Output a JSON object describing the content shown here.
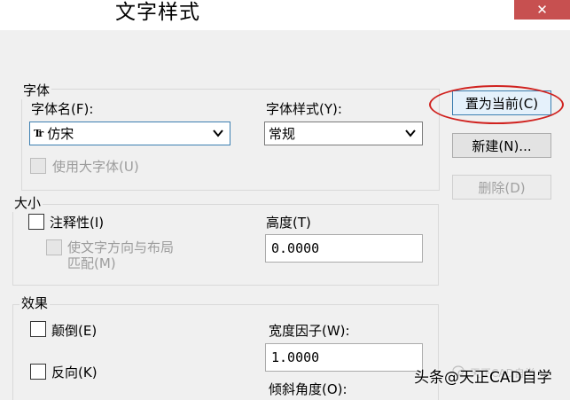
{
  "window": {
    "title": "文字样式",
    "close_glyph": "✕"
  },
  "font_group": {
    "legend": "字体",
    "font_name_label": "字体名(F):",
    "font_name_value": "仿宋",
    "font_name_icon": "Tr",
    "font_style_label": "字体样式(Y):",
    "font_style_value": "常规",
    "bigfont_label": "使用大字体(U)",
    "bigfont_checked": false
  },
  "size_group": {
    "legend": "大小",
    "annotative_label": "注释性(I)",
    "annotative_checked": false,
    "match_orientation_label_line1": "使文字方向与布局",
    "match_orientation_label_line2": "匹配(M)",
    "height_label": "高度(T)",
    "height_value": "0.0000"
  },
  "effects_group": {
    "legend": "效果",
    "upside_down_label": "颠倒(E)",
    "backwards_label": "反向(K)",
    "width_factor_label": "宽度因子(W):",
    "width_factor_value": "1.0000",
    "oblique_angle_label": "倾斜角度(O):"
  },
  "buttons": {
    "set_current": "置为当前(C)",
    "new": "新建(N)...",
    "delete": "删除(D)"
  },
  "watermark": {
    "text": "头条@天正CAD自学",
    "ghost_text": "天正CAD自学"
  },
  "colors": {
    "highlight_oval": "#d0221f",
    "close_button": "#c75050",
    "focus_border": "#3c7fb1"
  }
}
